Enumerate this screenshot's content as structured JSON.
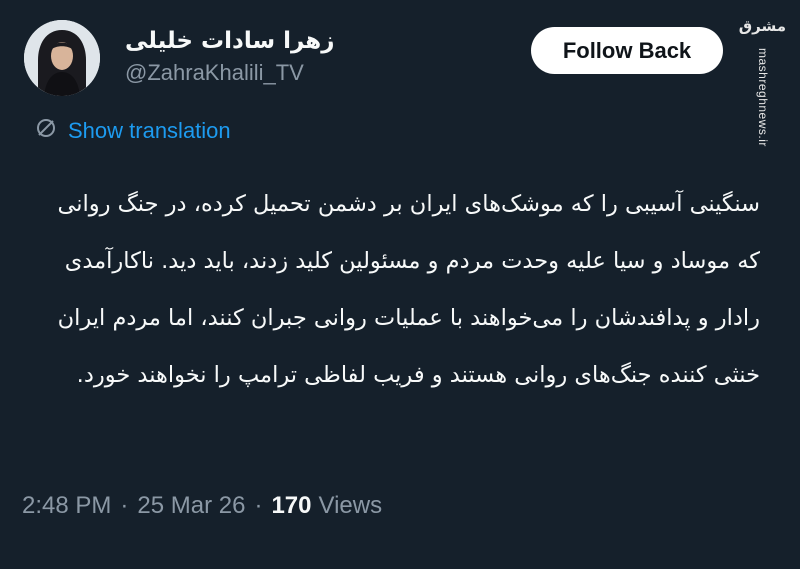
{
  "user": {
    "display_name": "زهرا سادات خلیلی",
    "handle": "@ZahraKhalili_TV"
  },
  "follow_button": {
    "label": "Follow Back"
  },
  "watermark": {
    "logo": "مشرق",
    "url": "mashreghnews.ir"
  },
  "translation": {
    "label": "Show translation",
    "icon": "translate-icon"
  },
  "tweet": {
    "text": "سنگینی آسیبی را که موشک‌های ایران بر دشمن تحمیل کرده، در جنگ روانی که موساد و سیا علیه وحدت مردم و مسئولین کلید زدند، باید دید. ناکارآمدی رادار و پدافندشان را می‌خواهند با عملیات روانی جبران کنند، اما مردم ایران خنثی کننده جنگ‌های روانی هستند و فریب لفاظی ترامپ را نخواهند خورد."
  },
  "meta": {
    "time": "2:48 PM",
    "date": "25 Mar 26",
    "views_count": "170",
    "views_label": "Views",
    "separator": "·"
  },
  "colors": {
    "background": "#15202b",
    "link": "#1d9bf0",
    "secondary_text": "#8b98a5"
  }
}
